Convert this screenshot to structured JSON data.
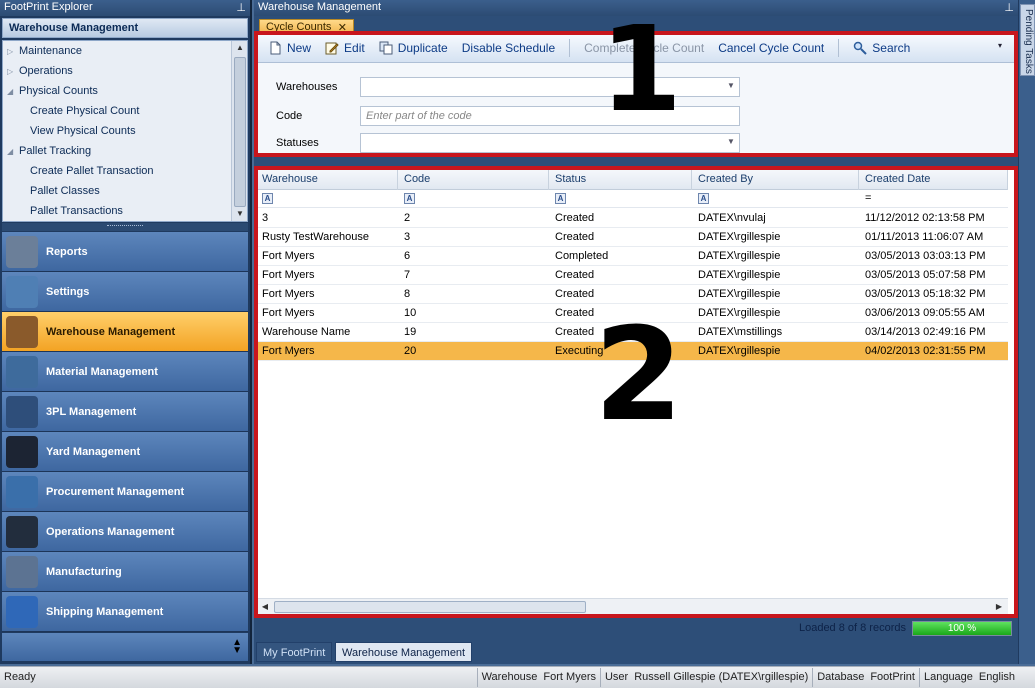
{
  "explorer": {
    "title": "FootPrint Explorer",
    "pin_glyph": "⊥",
    "subtitle": "Warehouse Management",
    "tree": [
      {
        "label": "Maintenance",
        "level": 0,
        "arrow": "▷"
      },
      {
        "label": "Operations",
        "level": 0,
        "arrow": "▷"
      },
      {
        "label": "Physical Counts",
        "level": 0,
        "arrow": "◢"
      },
      {
        "label": "Create Physical Count",
        "level": 1,
        "arrow": ""
      },
      {
        "label": "View Physical Counts",
        "level": 1,
        "arrow": ""
      },
      {
        "label": "Pallet Tracking",
        "level": 0,
        "arrow": "◢"
      },
      {
        "label": "Create Pallet Transaction",
        "level": 1,
        "arrow": ""
      },
      {
        "label": "Pallet Classes",
        "level": 1,
        "arrow": ""
      },
      {
        "label": "Pallet Transactions",
        "level": 1,
        "arrow": ""
      }
    ],
    "modules": [
      {
        "label": "Reports",
        "icon": "reports-icon",
        "color": "#6b7f99",
        "active": false
      },
      {
        "label": "Settings",
        "icon": "settings-icon",
        "color": "#4f7fb4",
        "active": false
      },
      {
        "label": "Warehouse Management",
        "icon": "warehouse-icon",
        "color": "#8a5a2b",
        "active": true
      },
      {
        "label": "Material Management",
        "icon": "material-icon",
        "color": "#3e6b9c",
        "active": false
      },
      {
        "label": "3PL Management",
        "icon": "3pl-icon",
        "color": "#2e4e7a",
        "active": false
      },
      {
        "label": "Yard Management",
        "icon": "yard-icon",
        "color": "#1c2433",
        "active": false
      },
      {
        "label": "Procurement Management",
        "icon": "procurement-icon",
        "color": "#3a6faa",
        "active": false
      },
      {
        "label": "Operations Management",
        "icon": "operations-icon",
        "color": "#222d3d",
        "active": false
      },
      {
        "label": "Manufacturing",
        "icon": "manufacturing-icon",
        "color": "#5c7392",
        "active": false
      },
      {
        "label": "Shipping Management",
        "icon": "shipping-icon",
        "color": "#2f68b8",
        "active": false
      }
    ]
  },
  "main": {
    "title": "Warehouse Management",
    "pin_glyph": "⊥",
    "doc_tab": {
      "label": "Cycle Counts",
      "close": "✕"
    },
    "toolbar": {
      "new": "New",
      "edit": "Edit",
      "duplicate": "Duplicate",
      "disable_schedule": "Disable Schedule",
      "complete_cycle_count": "Complete Cycle Count",
      "cancel_cycle_count": "Cancel Cycle Count",
      "search": "Search"
    },
    "filters": {
      "warehouses_label": "Warehouses",
      "code_label": "Code",
      "code_placeholder": "Enter part of the code",
      "statuses_label": "Statuses"
    },
    "grid": {
      "columns": [
        "Warehouse",
        "Code",
        "Status",
        "Created By",
        "Created Date"
      ],
      "date_filter_glyph": "=",
      "rows": [
        {
          "warehouse": "3",
          "code": "2",
          "status": "Created",
          "created_by": "DATEX\\nvulaj",
          "created_date": "11/12/2012 02:13:58 PM"
        },
        {
          "warehouse": "Rusty TestWarehouse",
          "code": "3",
          "status": "Created",
          "created_by": "DATEX\\rgillespie",
          "created_date": "01/11/2013 11:06:07 AM"
        },
        {
          "warehouse": "Fort Myers",
          "code": "6",
          "status": "Completed",
          "created_by": "DATEX\\rgillespie",
          "created_date": "03/05/2013 03:03:13 PM"
        },
        {
          "warehouse": "Fort Myers",
          "code": "7",
          "status": "Created",
          "created_by": "DATEX\\rgillespie",
          "created_date": "03/05/2013 05:07:58 PM"
        },
        {
          "warehouse": "Fort Myers",
          "code": "8",
          "status": "Created",
          "created_by": "DATEX\\rgillespie",
          "created_date": "03/05/2013 05:18:32 PM"
        },
        {
          "warehouse": "Fort Myers",
          "code": "10",
          "status": "Created",
          "created_by": "DATEX\\rgillespie",
          "created_date": "03/06/2013 09:05:55 AM"
        },
        {
          "warehouse": "Warehouse Name",
          "code": "19",
          "status": "Created",
          "created_by": "DATEX\\mstillings",
          "created_date": "03/14/2013 02:49:16 PM"
        },
        {
          "warehouse": "Fort Myers",
          "code": "20",
          "status": "Executing",
          "created_by": "DATEX\\rgillespie",
          "created_date": "04/02/2013 02:31:55 PM",
          "selected": true
        }
      ]
    },
    "annotations": {
      "one": "1",
      "two": "2"
    },
    "loaded_text": "Loaded 8 of 8 records",
    "progress": {
      "percent": 100,
      "label": "100 %"
    },
    "bottom_tabs": [
      "My FootPrint",
      "Warehouse Management"
    ]
  },
  "pending_tasks": "Pending Tasks",
  "statusbar": {
    "ready": "Ready",
    "warehouse_label": "Warehouse",
    "warehouse_value": "Fort Myers",
    "user_label": "User",
    "user_value": "Russell Gillespie (DATEX\\rgillespie)",
    "database_label": "Database",
    "database_value": "FootPrint",
    "language_label": "Language",
    "language_value": "English"
  },
  "colors": {
    "annotation_red": "#c8161d",
    "selection": "#f5b74a",
    "active_module": "#f3a324"
  }
}
